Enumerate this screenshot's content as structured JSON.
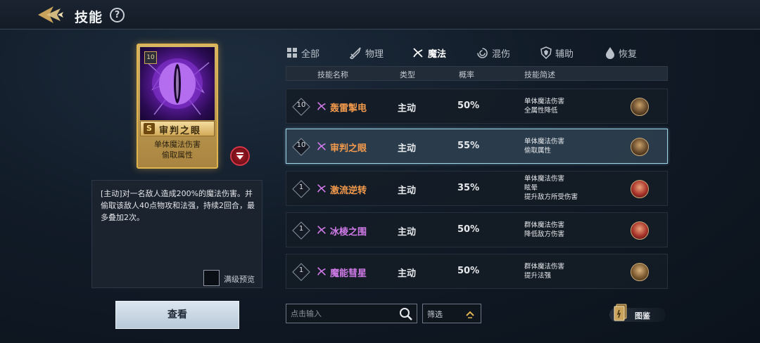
{
  "header": {
    "title": "技能",
    "help_label": "?"
  },
  "card": {
    "level": "10",
    "rank": "S",
    "name": "审判之眼",
    "desc_line1": "单体魔法伤害",
    "desc_line2": "偷取属性"
  },
  "description": {
    "text": "[主动]对一名敌人造成200%的魔法伤害。并偷取该敌人40点物攻和法强，持续2回合，最多叠加2次。",
    "maxlevel_label": "满级预览"
  },
  "view_button_label": "查看",
  "tabs": [
    {
      "label": "全部",
      "icon": "grid-icon"
    },
    {
      "label": "物理",
      "icon": "sword-icon"
    },
    {
      "label": "魔法",
      "icon": "magic-icon",
      "active": true
    },
    {
      "label": "混伤",
      "icon": "swirl-icon"
    },
    {
      "label": "辅助",
      "icon": "shield-icon"
    },
    {
      "label": "恢复",
      "icon": "drop-icon"
    }
  ],
  "table": {
    "headers": [
      "技能名称",
      "类型",
      "概率",
      "技能简述"
    ],
    "rows": [
      {
        "level": "10",
        "name": "轰雷掣电",
        "type": "主动",
        "rate": "50%",
        "desc": [
          "单体魔法伤害",
          "全属性降低"
        ],
        "name_color": "orange"
      },
      {
        "level": "10",
        "name": "审判之眼",
        "type": "主动",
        "rate": "55%",
        "desc": [
          "单体魔法伤害",
          "偷取属性"
        ],
        "name_color": "orange",
        "selected": true
      },
      {
        "level": "1",
        "name": "激流逆转",
        "type": "主动",
        "rate": "35%",
        "desc": [
          "单体魔法伤害",
          "眩晕",
          "提升敌方所受伤害"
        ],
        "name_color": "orange"
      },
      {
        "level": "1",
        "name": "冰棱之围",
        "type": "主动",
        "rate": "50%",
        "desc": [
          "群体魔法伤害",
          "降低敌方伤害"
        ],
        "name_color": "purple"
      },
      {
        "level": "1",
        "name": "魔能彗星",
        "type": "主动",
        "rate": "50%",
        "desc": [
          "群体魔法伤害",
          "提升法强"
        ],
        "name_color": "purple"
      }
    ]
  },
  "search": {
    "placeholder": "点击输入"
  },
  "filter_label": "筛选",
  "codex_label": "图鉴",
  "colors": {
    "accent_gold": "#e0b550",
    "name_orange": "#f39a4c",
    "name_purple": "#d07be8",
    "selected_border": "#9fd4e6"
  }
}
